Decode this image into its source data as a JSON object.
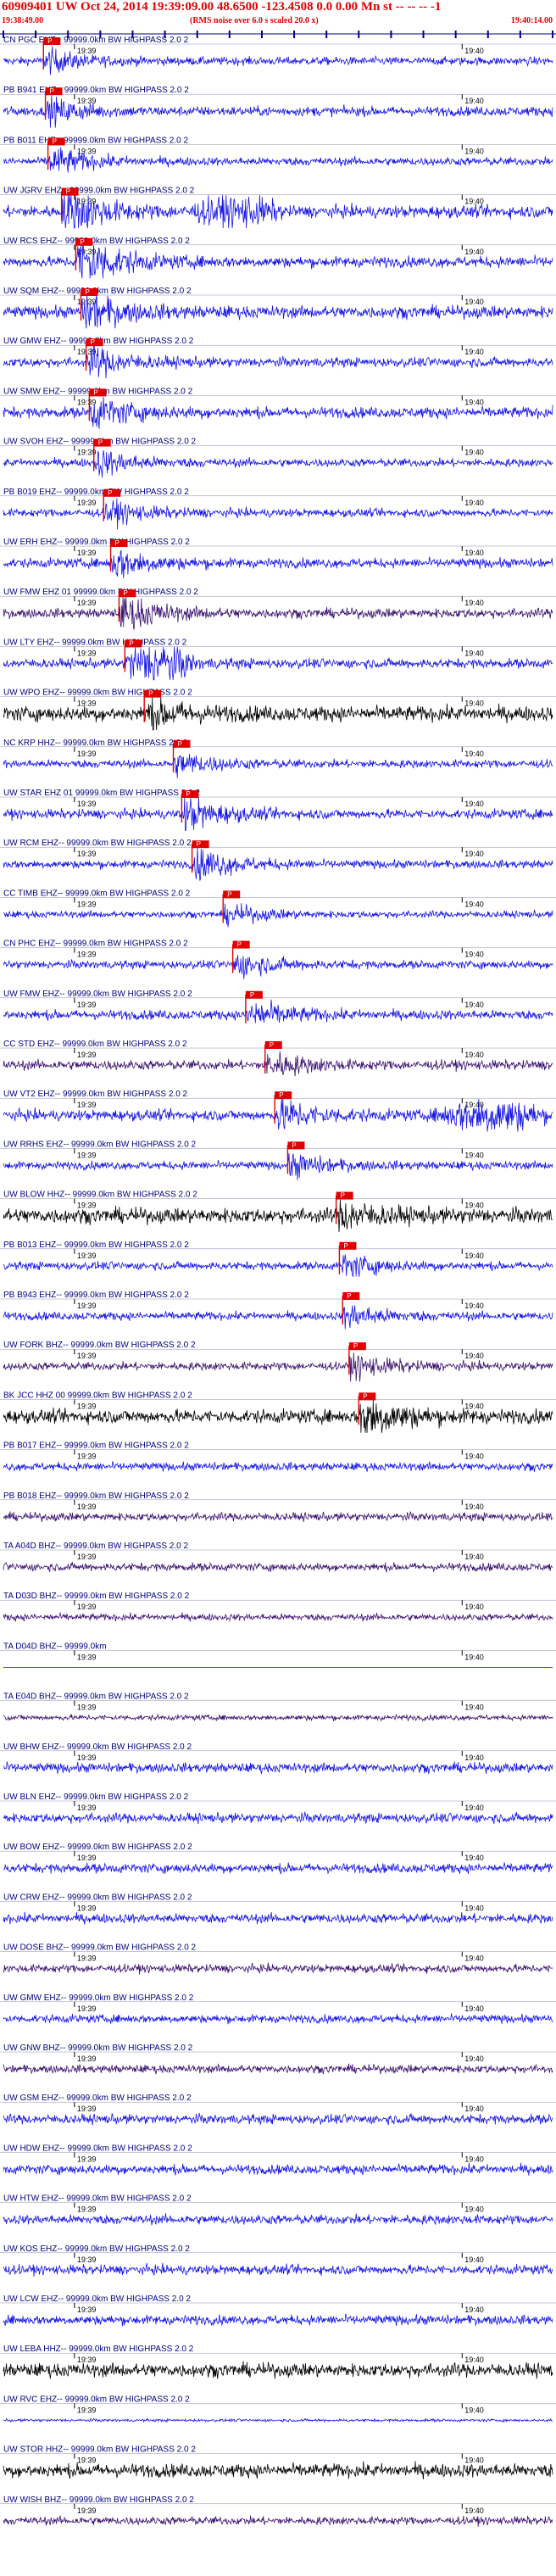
{
  "header": {
    "title": "60909401 UW Oct 24, 2014 19:39:09.00   48.6500 -123.4508  0.0 0.00 Mn st -- -- -- -1",
    "start_time": "19:38:49.00",
    "rms_note": "(RMS noise over 6.0 s scaled 20.0 x)",
    "end_time": "19:40:14.00"
  },
  "colors": {
    "header_text": "#e00000",
    "trace_blue": "#1414e6",
    "trace_purple": "#3a1070",
    "trace_black": "#000000",
    "pick_marker": "#e00000",
    "axis": "#000080"
  },
  "chart_data": {
    "type": "seismogram",
    "time_range_s": [
      0,
      85
    ],
    "tick_labels": {
      "t1939": "19:39",
      "t1940": "19:40"
    },
    "tick_positions_s": [
      11,
      71
    ],
    "marker_row": "P",
    "traces": [
      {
        "label": "CN PGC EHZ-- 99999.0km BW  HIGHPASS  2.0  2",
        "color": "blue",
        "amp": 0.3,
        "pick": 6.2,
        "event": 0.9
      },
      {
        "label": "PB B941 EHZ-- 99999.0km BW  HIGHPASS  2.0  2",
        "color": "blue",
        "amp": 0.35,
        "pick": 6.5,
        "event": 1.0
      },
      {
        "label": "PB B011 EHZ-- 99999.0km BW  HIGHPASS  2.0  2",
        "color": "blue",
        "amp": 0.3,
        "pick": 6.9,
        "event": 1.2
      },
      {
        "label": "UW JGRV EHZ-- 99999.0km BW  HIGHPASS  2.0  2",
        "color": "blue",
        "amp": 0.45,
        "pick": 9.0,
        "event": 2.2,
        "burst": [
          28,
          44,
          0.9
        ]
      },
      {
        "label": "UW RCS EHZ-- 99999.0km BW  HIGHPASS  2.0  2",
        "color": "blue",
        "amp": 0.4,
        "pick": 11.2,
        "event": 2.6
      },
      {
        "label": "UW SQM EHZ-- 99999.0km BW  HIGHPASS  2.0  2",
        "color": "blue",
        "amp": 0.45,
        "pick": 12.0,
        "event": 1.6
      },
      {
        "label": "UW GMW EHZ-- 99999.0km BW  HIGHPASS  2.0  2",
        "color": "blue",
        "amp": 0.35,
        "pick": 12.8,
        "event": 1.3
      },
      {
        "label": "UW SMW EHZ-- 99999.0km BW  HIGHPASS  2.0  2",
        "color": "blue",
        "amp": 0.4,
        "pick": 13.3,
        "event": 1.4
      },
      {
        "label": "UW SVOH EHZ-- 99999.0km BW  HIGHPASS  2.0  2",
        "color": "blue",
        "amp": 0.3,
        "pick": 14.0,
        "event": 1.1
      },
      {
        "label": "PB B019 EHZ-- 99999.0km BW  HIGHPASS  2.0  2",
        "color": "blue",
        "amp": 0.3,
        "pick": 15.5,
        "event": 1.0
      },
      {
        "label": "UW ERH EHZ-- 99999.0km BW  HIGHPASS  2.0  2",
        "color": "blue",
        "amp": 0.35,
        "pick": 16.6,
        "event": 1.3
      },
      {
        "label": "UW FMW EHZ 01 99999.0km BW  HIGHPASS  2.0  2",
        "color": "purple",
        "amp": 0.35,
        "pick": 17.9,
        "event": 1.6
      },
      {
        "label": "UW LTY EHZ-- 99999.0km BW  HIGHPASS  2.0  2",
        "color": "blue",
        "amp": 0.35,
        "pick": 18.8,
        "event": 1.3,
        "burst": [
          20,
          30,
          1.0
        ]
      },
      {
        "label": "UW WPO EHZ-- 99999.0km BW  HIGHPASS  2.0  2",
        "color": "black",
        "amp": 0.55,
        "pick": 21.8,
        "event": 1.2
      },
      {
        "label": "NC KRP HHZ-- 99999.0km BW  HIGHPASS  2.0  2",
        "color": "blue",
        "amp": 0.3,
        "pick": 26.3,
        "event": 1.0
      },
      {
        "label": "UW STAR EHZ 01 99999.0km BW  HIGHPASS  2.0  2",
        "color": "blue",
        "amp": 0.35,
        "pick": 27.6,
        "event": 1.4
      },
      {
        "label": "UW RCM EHZ-- 99999.0km BW  HIGHPASS  2.0  2",
        "color": "blue",
        "amp": 0.3,
        "pick": 29.2,
        "event": 1.5
      },
      {
        "label": "CC TIMB EHZ-- 99999.0km BW  HIGHPASS  2.0  2",
        "color": "blue",
        "amp": 0.25,
        "pick": 34.0,
        "event": 0.8
      },
      {
        "label": "CN PHC EHZ-- 99999.0km BW  HIGHPASS  2.0  2",
        "color": "blue",
        "amp": 0.3,
        "pick": 35.5,
        "event": 1.0
      },
      {
        "label": "UW FMW EHZ-- 99999.0km BW  HIGHPASS  2.0  2",
        "color": "blue",
        "amp": 0.35,
        "pick": 37.5,
        "event": 1.3
      },
      {
        "label": "CC STD EHZ-- 99999.0km BW  HIGHPASS  2.0  2",
        "color": "purple",
        "amp": 0.35,
        "pick": 40.5,
        "event": 1.1
      },
      {
        "label": "UW VT2 EHZ-- 99999.0km BW  HIGHPASS  2.0  2",
        "color": "blue",
        "amp": 0.4,
        "pick": 42.0,
        "event": 1.4,
        "burst": [
          66,
          85,
          1.1
        ]
      },
      {
        "label": "UW RRHS EHZ-- 99999.0km BW  HIGHPASS  2.0  2",
        "color": "blue",
        "amp": 0.3,
        "pick": 44.0,
        "event": 1.0
      },
      {
        "label": "UW BLOW HHZ-- 99999.0km BW  HIGHPASS  2.0  2",
        "color": "black",
        "amp": 0.55,
        "pick": 51.5,
        "event": 1.2
      },
      {
        "label": "PB B013 EHZ-- 99999.0km BW  HIGHPASS  2.0  2",
        "color": "blue",
        "amp": 0.3,
        "pick": 52.0,
        "event": 1.0
      },
      {
        "label": "PB B943 EHZ-- 99999.0km BW  HIGHPASS  2.0  2",
        "color": "blue",
        "amp": 0.3,
        "pick": 52.5,
        "event": 1.0
      },
      {
        "label": "UW FORK BHZ-- 99999.0km BW  HIGHPASS  2.0  2",
        "color": "purple",
        "amp": 0.3,
        "pick": 53.5,
        "event": 1.0
      },
      {
        "label": "BK JCC HHZ 00 99999.0km BW  HIGHPASS  2.0  2",
        "color": "black",
        "amp": 0.5,
        "pick": 55.0,
        "event": 2.0
      },
      {
        "label": "PB B017 EHZ-- 99999.0km BW  HIGHPASS  2.0  2",
        "color": "blue",
        "amp": 0.3
      },
      {
        "label": "PB B018 EHZ-- 99999.0km BW  HIGHPASS  2.0  2",
        "color": "purple",
        "amp": 0.3
      },
      {
        "label": "TA A04D BHZ-- 99999.0km BW  HIGHPASS  2.0  2",
        "color": "purple",
        "amp": 0.3
      },
      {
        "label": "TA D03D BHZ-- 99999.0km BW  HIGHPASS  2.0  2",
        "color": "purple",
        "amp": 0.25
      },
      {
        "label": "TA D04D BHZ-- 99999.0km",
        "color": "blue",
        "amp": 0.0
      },
      {
        "label": "TA E04D BHZ-- 99999.0km BW  HIGHPASS  2.0  2",
        "color": "purple",
        "amp": 0.2
      },
      {
        "label": "UW BHW EHZ-- 99999.0km BW  HIGHPASS  2.0  2",
        "color": "blue",
        "amp": 0.35
      },
      {
        "label": "UW BLN EHZ-- 99999.0km BW  HIGHPASS  2.0  2",
        "color": "blue",
        "amp": 0.35
      },
      {
        "label": "UW BOW EHZ-- 99999.0km BW  HIGHPASS  2.0  2",
        "color": "blue",
        "amp": 0.35
      },
      {
        "label": "UW CRW EHZ-- 99999.0km BW  HIGHPASS  2.0  2",
        "color": "blue",
        "amp": 0.35
      },
      {
        "label": "UW DOSE BHZ-- 99999.0km BW  HIGHPASS  2.0  2",
        "color": "purple",
        "amp": 0.3
      },
      {
        "label": "UW GMW EHZ-- 99999.0km BW  HIGHPASS  2.0  2",
        "color": "blue",
        "amp": 0.3
      },
      {
        "label": "UW GNW BHZ-- 99999.0km BW  HIGHPASS  2.0  2",
        "color": "purple",
        "amp": 0.3
      },
      {
        "label": "UW GSM EHZ-- 99999.0km BW  HIGHPASS  2.0  2",
        "color": "blue",
        "amp": 0.35
      },
      {
        "label": "UW HDW EHZ-- 99999.0km BW  HIGHPASS  2.0  2",
        "color": "blue",
        "amp": 0.35
      },
      {
        "label": "UW HTW EHZ-- 99999.0km BW  HIGHPASS  2.0  2",
        "color": "blue",
        "amp": 0.35
      },
      {
        "label": "UW KOS EHZ-- 99999.0km BW  HIGHPASS  2.0  2",
        "color": "blue",
        "amp": 0.35
      },
      {
        "label": "UW LCW EHZ-- 99999.0km BW  HIGHPASS  2.0  2",
        "color": "blue",
        "amp": 0.35
      },
      {
        "label": "UW LEBA HHZ-- 99999.0km BW  HIGHPASS  2.0  2",
        "color": "black",
        "amp": 0.5
      },
      {
        "label": "UW RVC EHZ-- 99999.0km BW  HIGHPASS  2.0  2",
        "color": "blue",
        "amp": 0.1
      },
      {
        "label": "UW STOR HHZ-- 99999.0km BW  HIGHPASS  2.0  2",
        "color": "black",
        "amp": 0.5
      },
      {
        "label": "UW WISH BHZ-- 99999.0km BW  HIGHPASS  2.0  2",
        "color": "purple",
        "amp": 0.3
      }
    ]
  }
}
